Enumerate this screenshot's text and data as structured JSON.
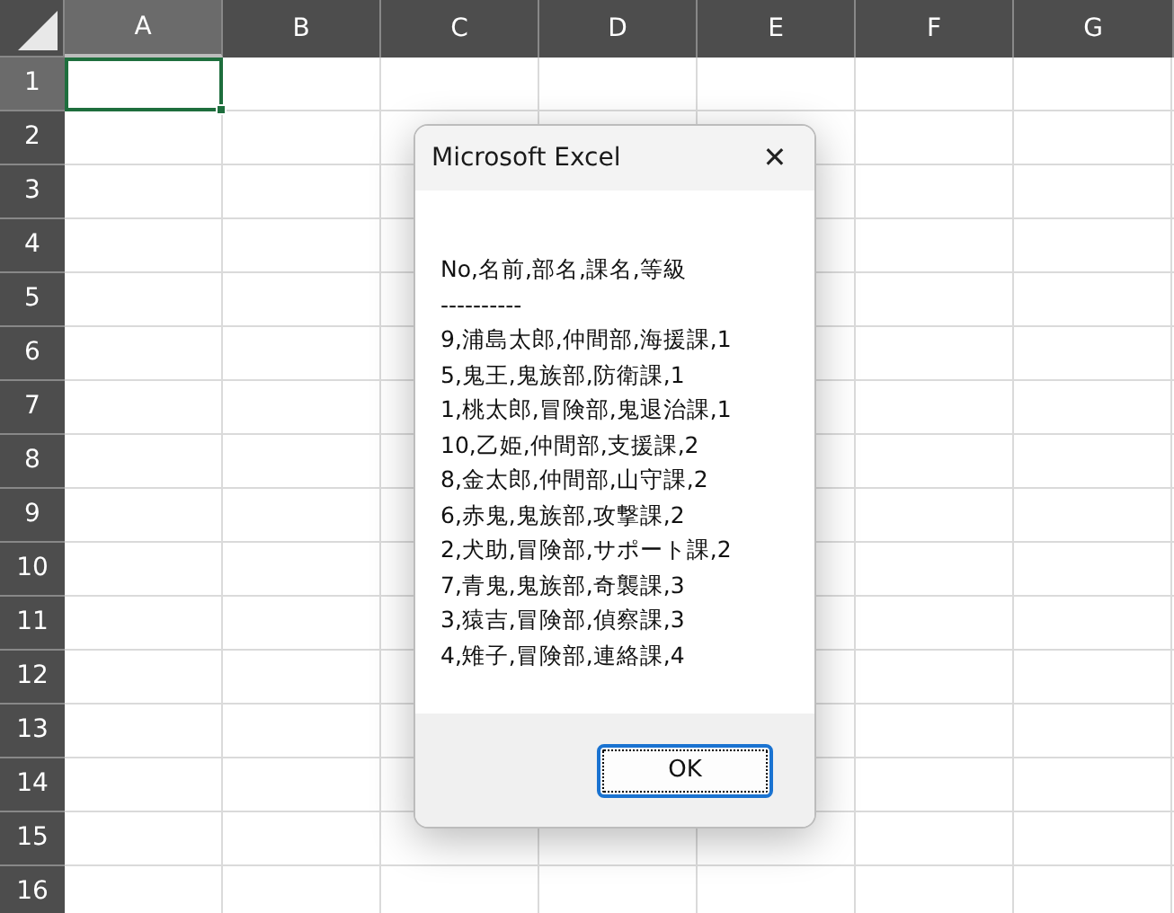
{
  "sheet": {
    "columns": [
      {
        "label": "A",
        "selected": true
      },
      {
        "label": "B",
        "selected": false
      },
      {
        "label": "C",
        "selected": false
      },
      {
        "label": "D",
        "selected": false
      },
      {
        "label": "E",
        "selected": false
      },
      {
        "label": "F",
        "selected": false
      },
      {
        "label": "G",
        "selected": false
      }
    ],
    "rows": [
      {
        "label": "1",
        "selected": true
      },
      {
        "label": "2",
        "selected": false
      },
      {
        "label": "3",
        "selected": false
      },
      {
        "label": "4",
        "selected": false
      },
      {
        "label": "5",
        "selected": false
      },
      {
        "label": "6",
        "selected": false
      },
      {
        "label": "7",
        "selected": false
      },
      {
        "label": "8",
        "selected": false
      },
      {
        "label": "9",
        "selected": false
      },
      {
        "label": "10",
        "selected": false
      },
      {
        "label": "11",
        "selected": false
      },
      {
        "label": "12",
        "selected": false
      },
      {
        "label": "13",
        "selected": false
      },
      {
        "label": "14",
        "selected": false
      },
      {
        "label": "15",
        "selected": false
      },
      {
        "label": "16",
        "selected": false
      }
    ]
  },
  "dialog": {
    "title": "Microsoft Excel",
    "close": "✕",
    "message_lines": [
      "No,名前,部名,課名,等級",
      "----------",
      "9,浦島太郎,仲間部,海援課,1",
      "5,鬼王,鬼族部,防衛課,1",
      "1,桃太郎,冒険部,鬼退治課,1",
      "10,乙姫,仲間部,支援課,2",
      "8,金太郎,仲間部,山守課,2",
      "6,赤鬼,鬼族部,攻撃課,2",
      "2,犬助,冒険部,サポート課,2",
      "7,青鬼,鬼族部,奇襲課,3",
      "3,猿吉,冒険部,偵察課,3",
      "4,雉子,冒険部,連絡課,4"
    ],
    "buttons": [
      "OK"
    ]
  }
}
